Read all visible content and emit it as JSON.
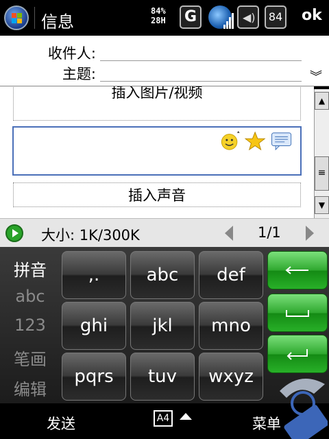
{
  "titlebar": {
    "title": "信息",
    "status_text_line1": "84%",
    "status_text_line2": "28H",
    "network_type": "G",
    "battery_value": "84",
    "ok_label": "ok",
    "icons": [
      "windows-start-icon",
      "signal-globe-icon",
      "volume-icon",
      "battery-icon"
    ]
  },
  "header": {
    "to_label": "收件人:",
    "to_value": "",
    "subject_label": "主题:",
    "subject_value": ""
  },
  "body": {
    "insert_picture_label": "插入图片/视频",
    "message_value": "",
    "message_icons": [
      "smiley-icon",
      "star-icon",
      "speech-bubble-icon"
    ],
    "insert_sound_label": "插入声音"
  },
  "sizebar": {
    "size_text": "大小: 1K/300K",
    "page_text": "1/1"
  },
  "keyboard": {
    "modes": [
      "拼音",
      "abc",
      "123",
      "笔画",
      "编辑"
    ],
    "active_mode": "拼音",
    "keys": [
      ",.",
      "abc",
      "def",
      "ghi",
      "jkl",
      "mno",
      "pqrs",
      "tuv",
      "wxyz"
    ],
    "function_keys": [
      "backspace",
      "space",
      "enter"
    ]
  },
  "menubar": {
    "left_label": "发送",
    "sip_label": "A4",
    "right_label": "菜单"
  },
  "colors": {
    "accent_green": "#29a329",
    "focus_border": "#4a6fb8",
    "title_bg": "#000000"
  }
}
